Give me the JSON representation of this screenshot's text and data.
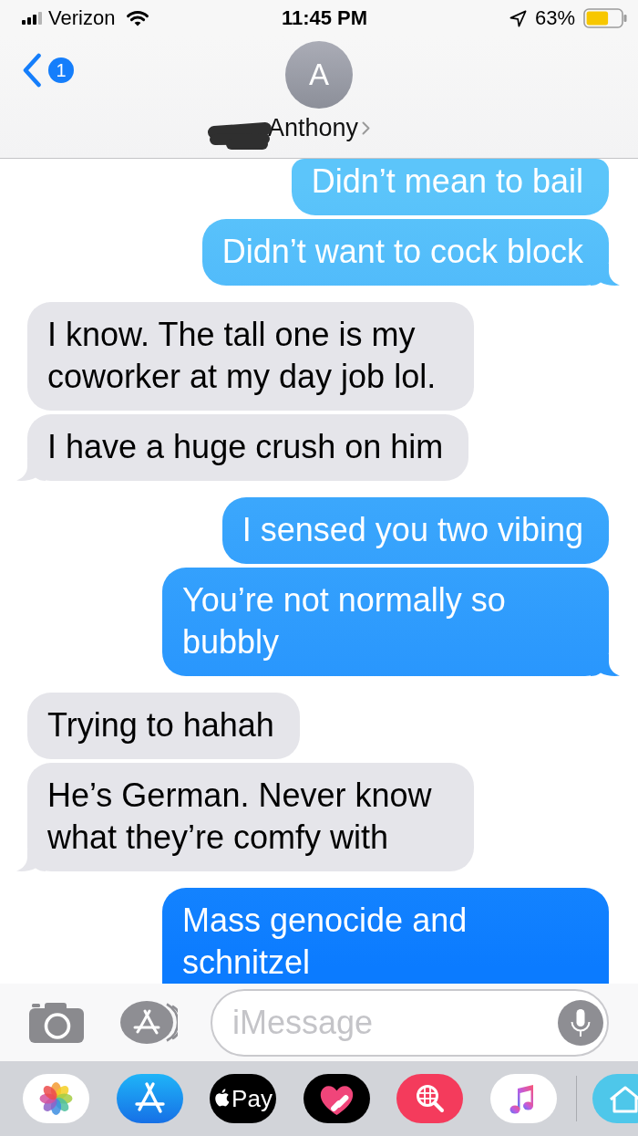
{
  "status_bar": {
    "carrier": "Verizon",
    "time": "11:45 PM",
    "battery": "63%"
  },
  "header": {
    "back_badge": "1",
    "contact": {
      "initial": "A",
      "name": "Anthony",
      "redacted": true
    }
  },
  "messages": [
    {
      "kind": "sent",
      "text": "Didn’t mean to bail"
    },
    {
      "kind": "sent",
      "text": "Didn’t want to cock block"
    },
    {
      "kind": "received",
      "text": "I know. The tall one is my coworker at my day job lol."
    },
    {
      "kind": "received",
      "text": "I have a huge crush on him"
    },
    {
      "kind": "sent",
      "text": "I sensed you two vibing"
    },
    {
      "kind": "sent",
      "text": "You’re not normally so bubbly"
    },
    {
      "kind": "received",
      "text": "Trying to hahah"
    },
    {
      "kind": "received",
      "text": "He’s German. Never know what they’re comfy with"
    },
    {
      "kind": "sent",
      "text": "Mass genocide and schnitzel"
    }
  ],
  "composer": {
    "placeholder": "iMessage"
  },
  "app_drawer": {
    "apps": [
      {
        "kind": "photos"
      },
      {
        "kind": "app_store"
      },
      {
        "kind": "apple_pay",
        "label": "Pay"
      },
      {
        "kind": "heart_stickers"
      },
      {
        "kind": "image_search"
      },
      {
        "kind": "music"
      }
    ],
    "more_apps": [
      {
        "kind": "home"
      }
    ]
  }
}
